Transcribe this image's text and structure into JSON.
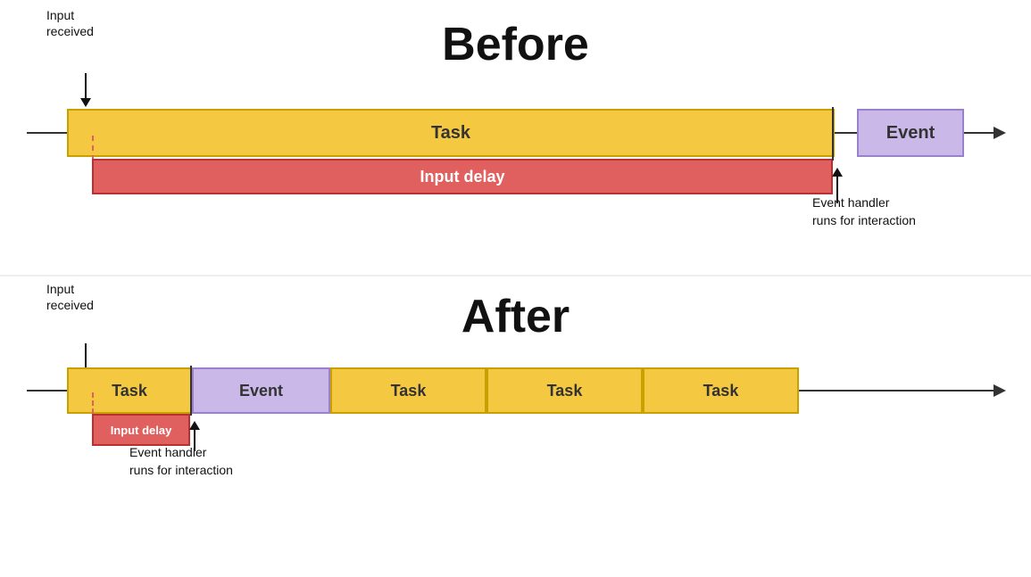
{
  "before": {
    "title": "Before",
    "input_received": "Input\nreceived",
    "task_label": "Task",
    "event_label": "Event",
    "input_delay_label": "Input delay",
    "event_handler_label": "Event handler\nruns for interaction"
  },
  "after": {
    "title": "After",
    "input_received": "Input\nreceived",
    "task_label_1": "Task",
    "event_label": "Event",
    "task_label_2": "Task",
    "task_label_3": "Task",
    "task_label_4": "Task",
    "input_delay_label": "Input delay",
    "event_handler_label": "Event handler\nruns for interaction"
  },
  "colors": {
    "task_fill": "#f5c842",
    "task_border": "#c9a000",
    "event_fill": "#c9b8e8",
    "event_border": "#9b80cc",
    "delay_fill": "#e06060",
    "delay_border": "#b83030",
    "timeline": "#333",
    "text_dark": "#111",
    "text_white": "#fff"
  }
}
